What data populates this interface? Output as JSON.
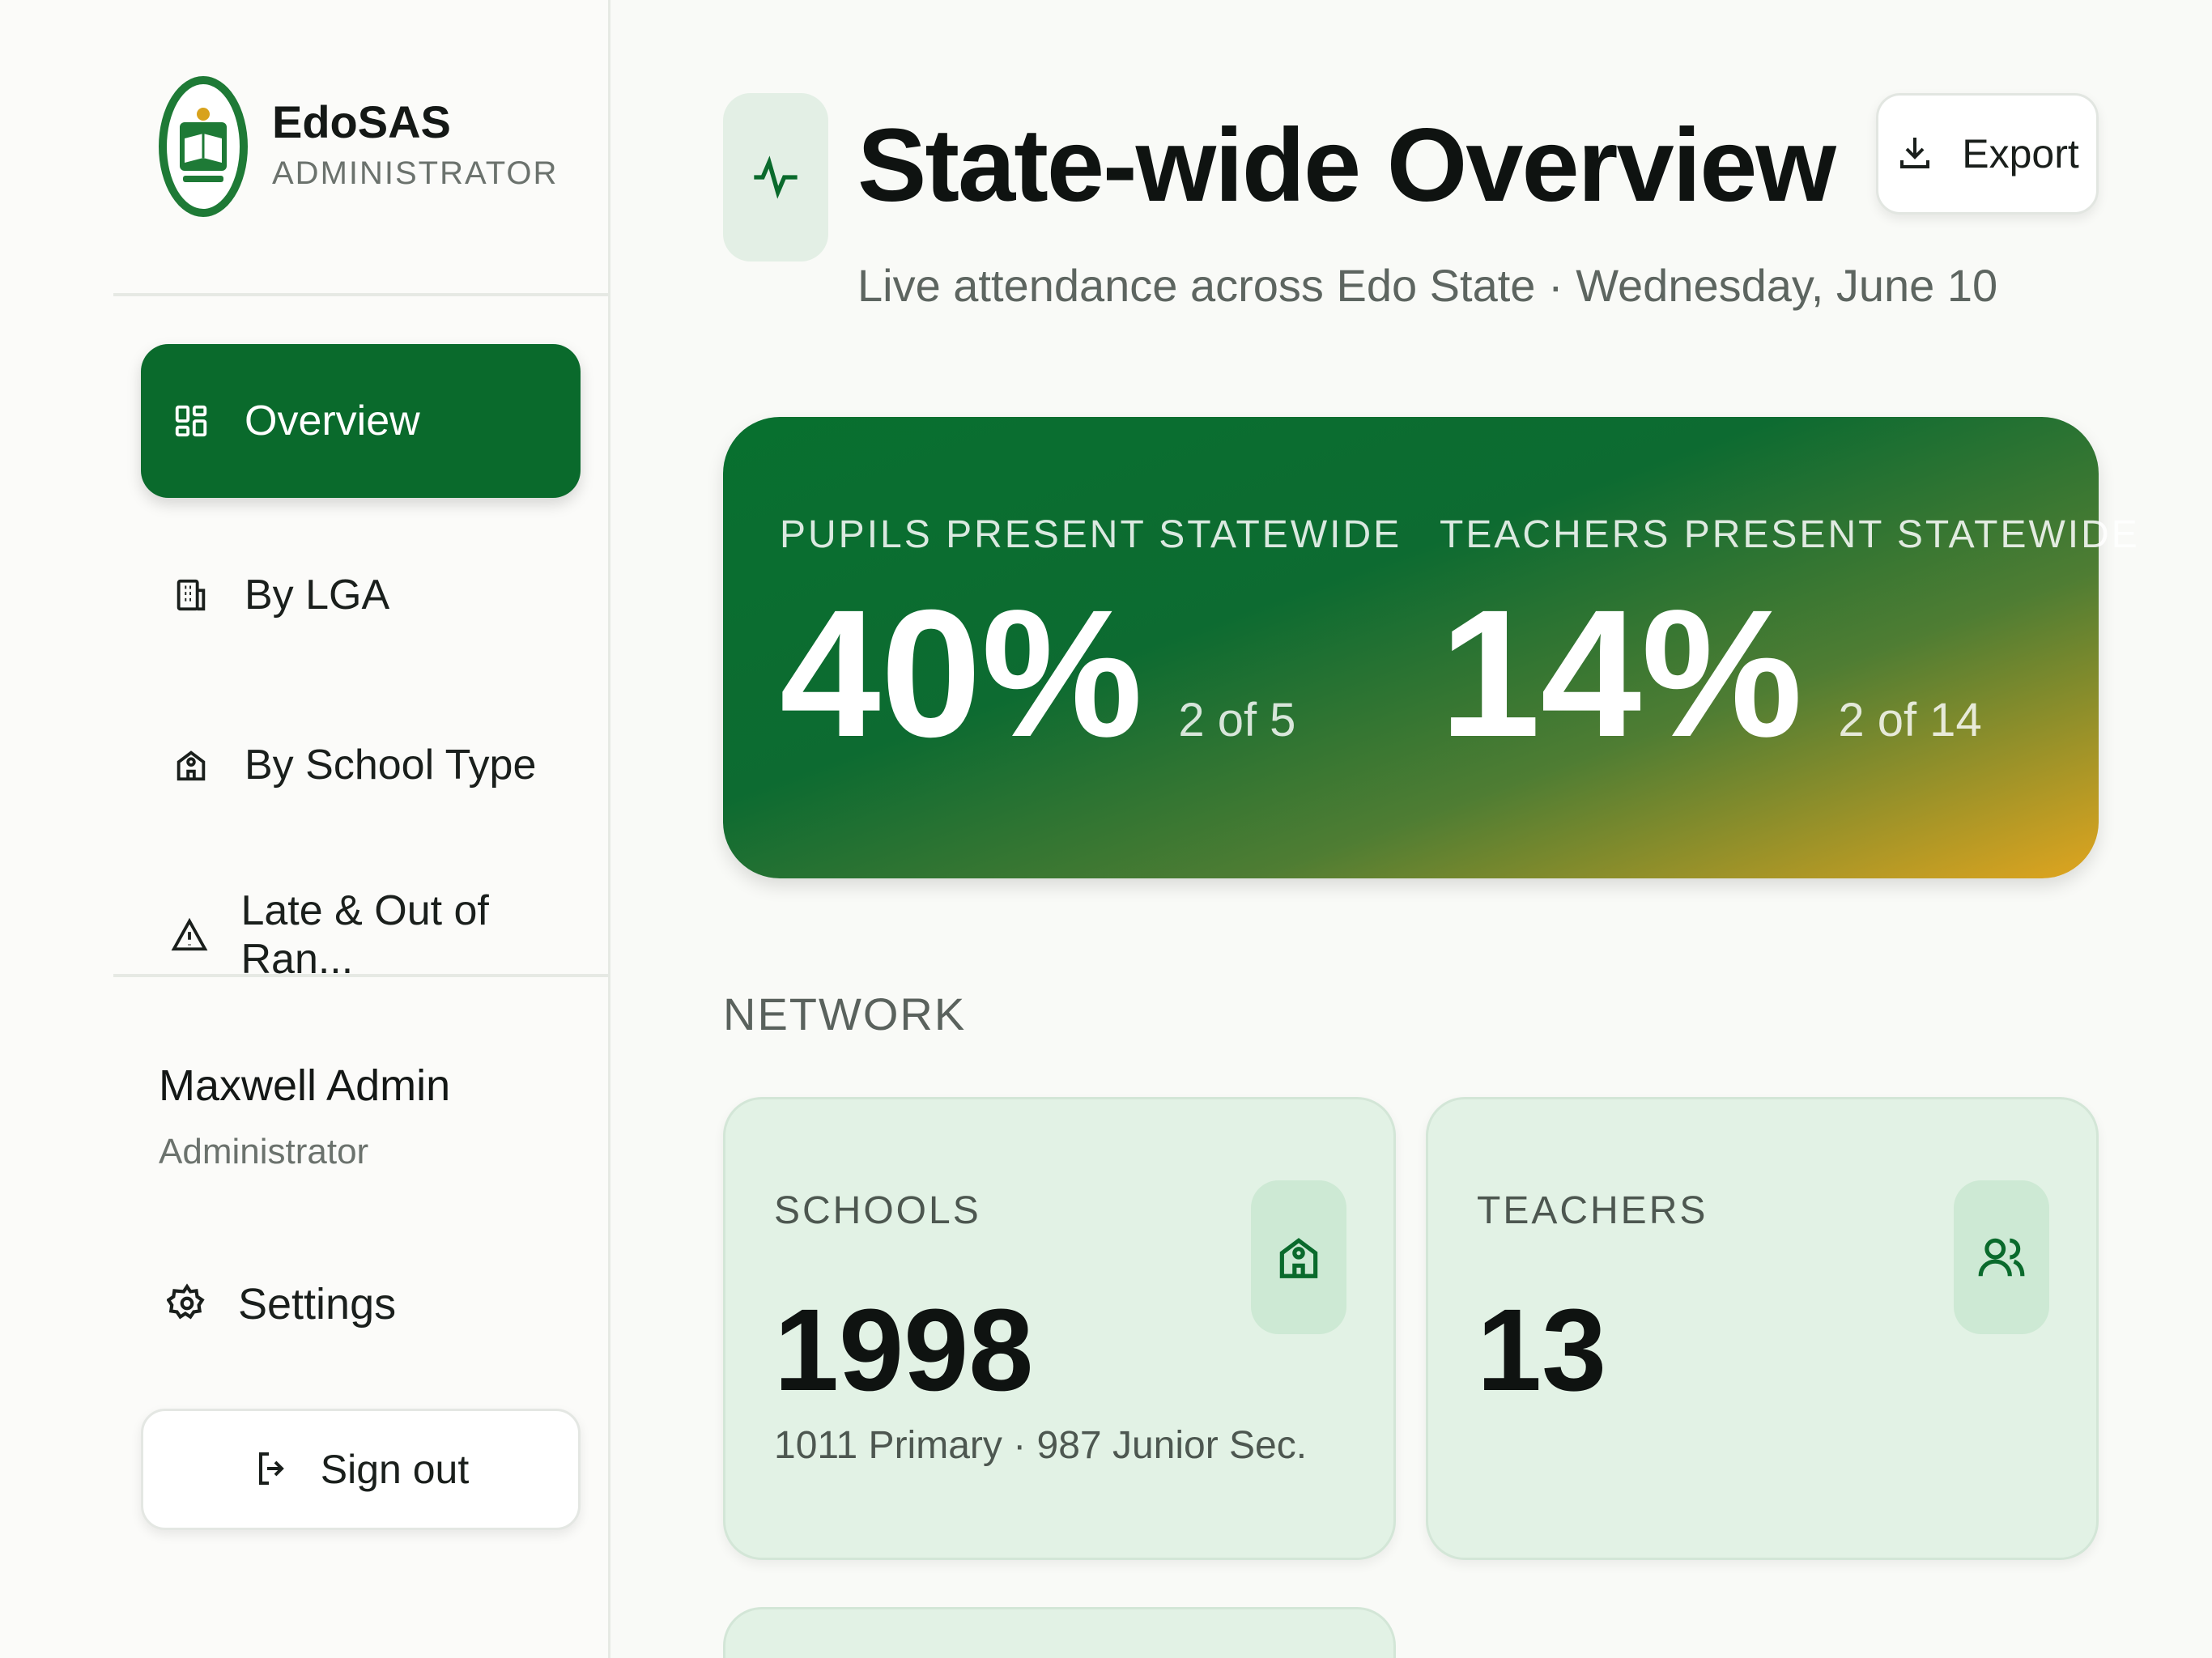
{
  "brand": {
    "name": "EdoSAS",
    "role": "ADMINISTRATOR",
    "logo_icon": "edo-state-crest-logo"
  },
  "sidebar": {
    "items": [
      {
        "label": "Overview",
        "icon": "grid-icon",
        "active": true
      },
      {
        "label": "By LGA",
        "icon": "building-icon",
        "active": false
      },
      {
        "label": "By School Type",
        "icon": "school-icon",
        "active": false
      },
      {
        "label": "Late & Out of Ran...",
        "icon": "warning-icon",
        "active": false
      }
    ]
  },
  "user": {
    "name": "Maxwell Admin",
    "role": "Administrator"
  },
  "settings_label": "Settings",
  "signout_label": "Sign out",
  "header": {
    "title": "State-wide Overview",
    "subtitle": "Live attendance across Edo State · Wednesday, June 10",
    "export_label": "Export"
  },
  "hero": {
    "pupils": {
      "label": "PUPILS PRESENT STATEWIDE",
      "value": "40%",
      "note": "2 of 5"
    },
    "teachers": {
      "label": "TEACHERS PRESENT STATEWIDE",
      "value": "14%",
      "note": "2 of 14"
    }
  },
  "network": {
    "section_label": "NETWORK",
    "schools": {
      "label": "SCHOOLS",
      "value": "1998",
      "note": "1011 Primary · 987 Junior Sec.",
      "icon": "school-icon"
    },
    "teachers": {
      "label": "TEACHERS",
      "value": "13",
      "note": "",
      "icon": "users-icon"
    }
  },
  "colors": {
    "primary": "#0a6a2c",
    "accent": "#e0a51f",
    "card_bg": "#e2f2e5"
  }
}
